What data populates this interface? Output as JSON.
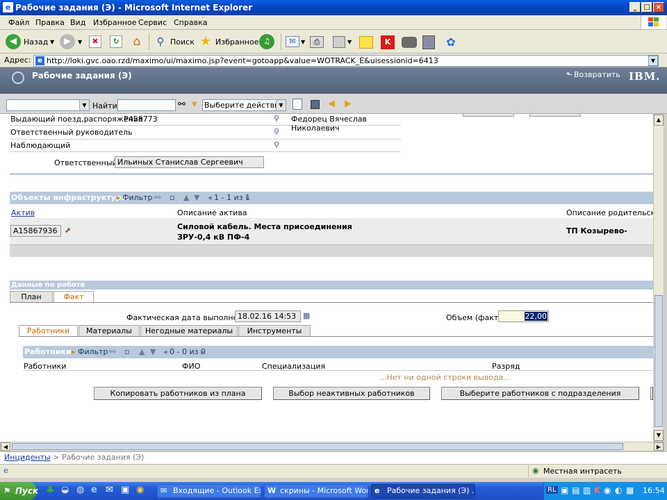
{
  "window": {
    "title": "Рабочие задания (Э) - Microsoft Internet Explorer"
  },
  "menu": [
    "Файл",
    "Правка",
    "Вид",
    "Избранное",
    "Сервис",
    "Справка"
  ],
  "toolbar": {
    "back": "Назад",
    "search": "Поиск",
    "favorites": "Избранное"
  },
  "address": {
    "label": "Адрес:",
    "url": "http://loki.gvc.oao.rzd/maximo/ui/maximo.jsp?event=gotoapp&value=WOTRACK_E&uisessionid=6413"
  },
  "app": {
    "title": "Рабочие задания (Э)",
    "return_label": "Возвратить",
    "brand": "IBM."
  },
  "apptoolbar": {
    "find_label": "Найти:",
    "action_select": "Выберите действие"
  },
  "form": {
    "rows": [
      {
        "label": "Выдающий поезд,распоряжение",
        "value": "Р458773",
        "person": "Федорец Вячеслав Николаевич"
      },
      {
        "label": "Ответственный руководитель",
        "value": "",
        "person": ""
      },
      {
        "label": "Наблюдающий",
        "value": "",
        "person": ""
      }
    ],
    "responsible_label": "Ответственный",
    "responsible_value": "Ильиных Станислав Сергеевич"
  },
  "infra": {
    "title": "Объекты инфраструктуры",
    "filter": "Фильтр",
    "paging": "1 - 1 из 1",
    "columns": [
      "Актив",
      "Описание актива",
      "Описание родительского а"
    ],
    "row": {
      "asset": "А15867936",
      "desc_line1": "Силовой кабель. Места присоединения",
      "desc_line2": "ЗРУ-0,4 кВ ПФ-4",
      "parent": "ТП Козырево-"
    }
  },
  "work": {
    "title": "Данные по работе",
    "tabs": [
      "План",
      "Факт"
    ],
    "actual_date_label": "Фактическая дата выполнения",
    "actual_date": "18.02.16 14:53",
    "volume_label": "Объем (факт)",
    "volume": "22,00",
    "subtabs": [
      "Работники",
      "Материалы",
      "Негодные материалы",
      "Инструменты"
    ],
    "workers": {
      "title": "Работники",
      "filter": "Фильтр",
      "paging": "0 - 0 из 0",
      "columns": [
        "Работники",
        "ФИО",
        "Специализация",
        "Разряд"
      ],
      "empty": "...Нет ни одной строки вывода...",
      "buttons": [
        "Копировать работников из плана",
        "Выбор неактивных работников",
        "Выберите работников с подразделения"
      ]
    }
  },
  "breadcrumb": {
    "link": "Инциденты",
    "current": " > Рабочие задания (Э)"
  },
  "status": {
    "zone": "Местная интрасеть"
  },
  "taskbar": {
    "start": "Пуск",
    "tasks": [
      "Входящие - Outlook Exp...",
      "скрины - Microsoft Word",
      "Рабочие задания (Э) ..."
    ],
    "lang": "RL",
    "clock": "16:54"
  }
}
